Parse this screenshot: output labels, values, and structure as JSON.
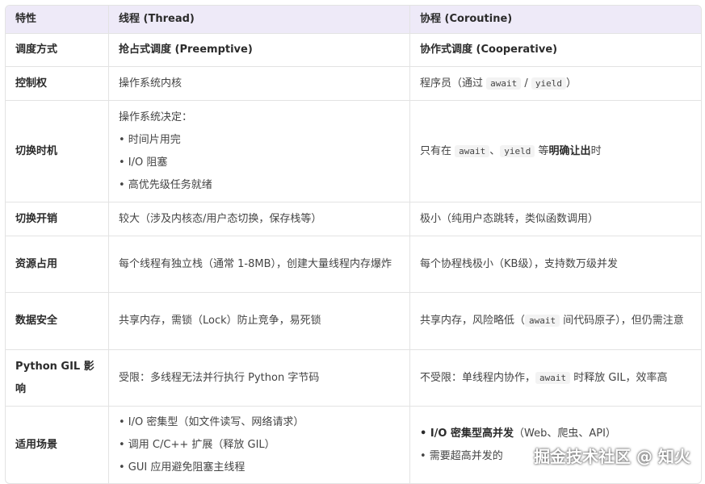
{
  "headers": [
    "特性",
    "线程 (Thread)",
    "协程 (Coroutine)"
  ],
  "rows": [
    {
      "feature": "调度方式",
      "thread": "抢占式调度 (Preemptive)",
      "coroutine": "协作式调度 (Cooperative)"
    },
    {
      "feature": "控制权",
      "thread": "操作系统内核",
      "coroutine_prefix": "程序员（通过 ",
      "coroutine_code1": "await",
      "coroutine_sep": " / ",
      "coroutine_code2": "yield",
      "coroutine_suffix": "）"
    },
    {
      "feature": "切换时机",
      "thread_intro": "操作系统决定：",
      "thread_bullets": [
        "• 时间片用完",
        "• I/O 阻塞",
        "• 高优先级任务就绪"
      ],
      "coroutine_prefix": "只有在 ",
      "coroutine_code1": "await",
      "coroutine_sep": "、",
      "coroutine_code2": "yield",
      "coroutine_mid": " 等",
      "coroutine_bold": "明确让出",
      "coroutine_suffix": "时"
    },
    {
      "feature": "切换开销",
      "thread": "较大（涉及内核态/用户态切换，保存栈等）",
      "coroutine": "极小（纯用户态跳转，类似函数调用）"
    },
    {
      "feature": "资源占用",
      "thread": "每个线程有独立栈（通常 1-8MB），创建大量线程内存爆炸",
      "coroutine": "每个协程栈极小（KB级），支持数万级并发"
    },
    {
      "feature": "数据安全",
      "thread": "共享内存，需锁（Lock）防止竞争，易死锁",
      "coroutine_prefix": "共享内存，风险略低（",
      "coroutine_code1": "await",
      "coroutine_suffix": " 间代码原子），但仍需注意"
    },
    {
      "feature": "Python GIL 影响",
      "thread": "受限：多线程无法并行执行 Python 字节码",
      "coroutine_prefix": "不受限：单线程内协作，",
      "coroutine_code1": "await",
      "coroutine_suffix": " 时释放 GIL，效率高"
    },
    {
      "feature": "适用场景",
      "thread_bullets": [
        "• I/O 密集型（如文件读写、网络请求）",
        "• 调用 C/C++ 扩展（释放 GIL）",
        "• GUI 应用避免阻塞主线程"
      ],
      "coroutine_bullet1_bold": "• I/O 密集型高并发",
      "coroutine_bullet1_rest": "（Web、爬虫、API）",
      "coroutine_bullet2": "• 需要超高并发的"
    }
  ],
  "watermark": "掘金技术社区 @ 知火"
}
